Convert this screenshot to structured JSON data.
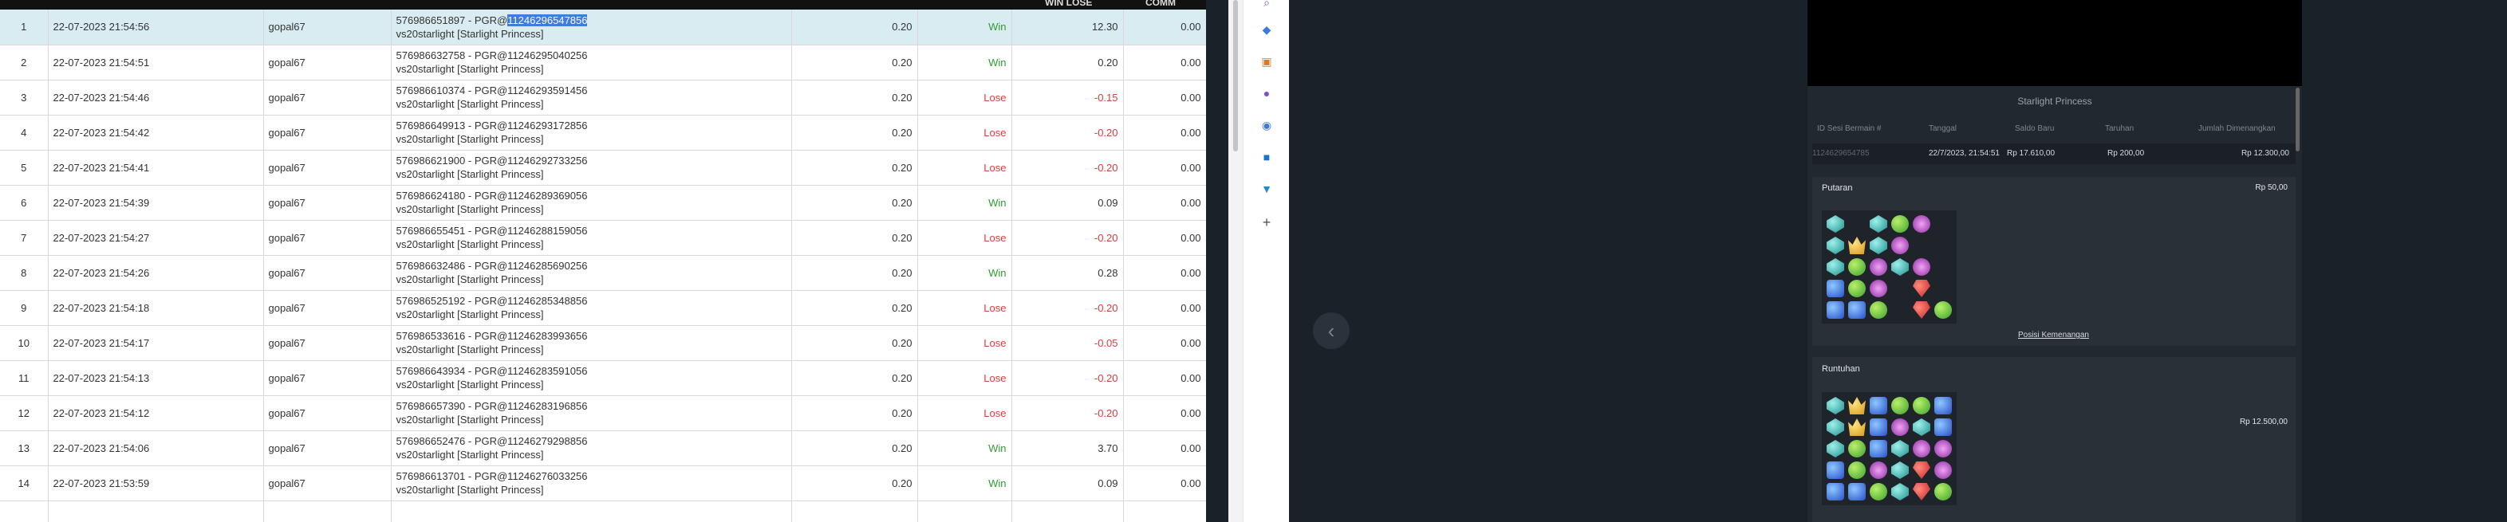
{
  "table": {
    "headers": {
      "win_lose": "WIN LOSE",
      "comm": "COMM"
    },
    "rows": [
      {
        "no": "1",
        "date": "22-07-2023 21:54:56",
        "user": "gopal67",
        "id_prefix": "576986651897 - PGR@",
        "id_highlight": "11246296547856",
        "game": "vs20starlight [Starlight Princess]",
        "bet": "0.20",
        "result": "Win",
        "amount": "12.30",
        "comm": "0.00"
      },
      {
        "no": "2",
        "date": "22-07-2023 21:54:51",
        "user": "gopal67",
        "id_prefix": "576986632758 - PGR@11246295040256",
        "id_highlight": "",
        "game": "vs20starlight [Starlight Princess]",
        "bet": "0.20",
        "result": "Win",
        "amount": "0.20",
        "comm": "0.00"
      },
      {
        "no": "3",
        "date": "22-07-2023 21:54:46",
        "user": "gopal67",
        "id_prefix": "576986610374 - PGR@11246293591456",
        "id_highlight": "",
        "game": "vs20starlight [Starlight Princess]",
        "bet": "0.20",
        "result": "Lose",
        "amount": "-0.15",
        "comm": "0.00"
      },
      {
        "no": "4",
        "date": "22-07-2023 21:54:42",
        "user": "gopal67",
        "id_prefix": "576986649913 - PGR@11246293172856",
        "id_highlight": "",
        "game": "vs20starlight [Starlight Princess]",
        "bet": "0.20",
        "result": "Lose",
        "amount": "-0.20",
        "comm": "0.00"
      },
      {
        "no": "5",
        "date": "22-07-2023 21:54:41",
        "user": "gopal67",
        "id_prefix": "576986621900 - PGR@11246292733256",
        "id_highlight": "",
        "game": "vs20starlight [Starlight Princess]",
        "bet": "0.20",
        "result": "Lose",
        "amount": "-0.20",
        "comm": "0.00"
      },
      {
        "no": "6",
        "date": "22-07-2023 21:54:39",
        "user": "gopal67",
        "id_prefix": "576986624180 - PGR@11246289369056",
        "id_highlight": "",
        "game": "vs20starlight [Starlight Princess]",
        "bet": "0.20",
        "result": "Win",
        "amount": "0.09",
        "comm": "0.00"
      },
      {
        "no": "7",
        "date": "22-07-2023 21:54:27",
        "user": "gopal67",
        "id_prefix": "576986655451 - PGR@11246288159056",
        "id_highlight": "",
        "game": "vs20starlight [Starlight Princess]",
        "bet": "0.20",
        "result": "Lose",
        "amount": "-0.20",
        "comm": "0.00"
      },
      {
        "no": "8",
        "date": "22-07-2023 21:54:26",
        "user": "gopal67",
        "id_prefix": "576986632486 - PGR@11246285690256",
        "id_highlight": "",
        "game": "vs20starlight [Starlight Princess]",
        "bet": "0.20",
        "result": "Win",
        "amount": "0.28",
        "comm": "0.00"
      },
      {
        "no": "9",
        "date": "22-07-2023 21:54:18",
        "user": "gopal67",
        "id_prefix": "576986525192 - PGR@11246285348856",
        "id_highlight": "",
        "game": "vs20starlight [Starlight Princess]",
        "bet": "0.20",
        "result": "Lose",
        "amount": "-0.20",
        "comm": "0.00"
      },
      {
        "no": "10",
        "date": "22-07-2023 21:54:17",
        "user": "gopal67",
        "id_prefix": "576986533616 - PGR@11246283993656",
        "id_highlight": "",
        "game": "vs20starlight [Starlight Princess]",
        "bet": "0.20",
        "result": "Lose",
        "amount": "-0.05",
        "comm": "0.00"
      },
      {
        "no": "11",
        "date": "22-07-2023 21:54:13",
        "user": "gopal67",
        "id_prefix": "576986643934 - PGR@11246283591056",
        "id_highlight": "",
        "game": "vs20starlight [Starlight Princess]",
        "bet": "0.20",
        "result": "Lose",
        "amount": "-0.20",
        "comm": "0.00"
      },
      {
        "no": "12",
        "date": "22-07-2023 21:54:12",
        "user": "gopal67",
        "id_prefix": "576986657390 - PGR@11246283196856",
        "id_highlight": "",
        "game": "vs20starlight [Starlight Princess]",
        "bet": "0.20",
        "result": "Lose",
        "amount": "-0.20",
        "comm": "0.00"
      },
      {
        "no": "13",
        "date": "22-07-2023 21:54:06",
        "user": "gopal67",
        "id_prefix": "576986652476 - PGR@11246279298856",
        "id_highlight": "",
        "game": "vs20starlight [Starlight Princess]",
        "bet": "0.20",
        "result": "Win",
        "amount": "3.70",
        "comm": "0.00"
      },
      {
        "no": "14",
        "date": "22-07-2023 21:53:59",
        "user": "gopal67",
        "id_prefix": "576986613701 - PGR@11246276033256",
        "id_highlight": "",
        "game": "vs20starlight [Starlight Princess]",
        "bet": "0.20",
        "result": "Win",
        "amount": "0.09",
        "comm": "0.00"
      }
    ]
  },
  "extensions": [
    "search-icon",
    "tag-icon",
    "briefcase-icon",
    "people-icon",
    "chrome-icon",
    "outlook-icon",
    "cart-icon",
    "plus-icon"
  ],
  "game": {
    "title": "Starlight Princess",
    "headers": {
      "id": "ID Sesi Bermain #",
      "date": "Tanggal",
      "balance": "Saldo Baru",
      "bet": "Taruhan",
      "win": "Jumlah Dimenangkan"
    },
    "info": {
      "id": "1124629654785",
      "date": "22/7/2023, 21:54:51",
      "balance": "Rp 17.610,00",
      "bet": "Rp 200,00",
      "win": "Rp 12.300,00"
    },
    "spin": {
      "title": "Putaran",
      "amount": "Rp 50,00"
    },
    "tumble": {
      "title": "Runtuhan",
      "amount": "Rp 12.500,00"
    },
    "pos_link": "Posisi Kemenangan"
  }
}
